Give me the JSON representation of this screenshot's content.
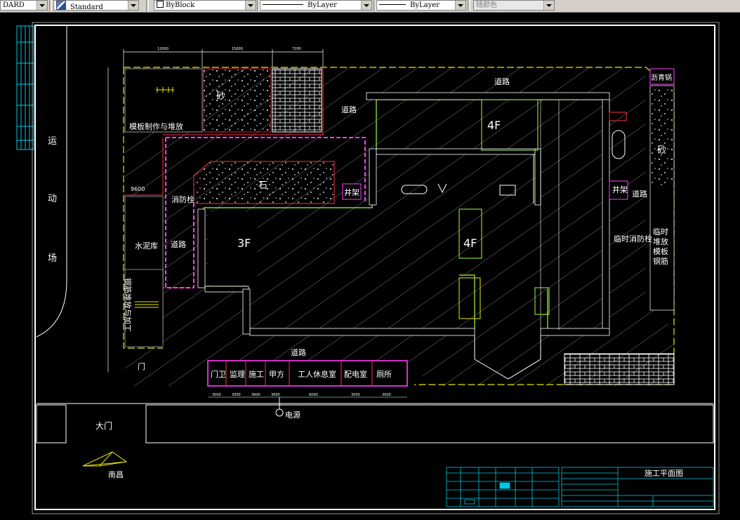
{
  "toolbar": {
    "textstyle": "DARD",
    "dimstyle": "Standard",
    "layer": "ByBlock",
    "linetype": "ByLayer",
    "lineweight": "ByLayer",
    "plotstyle": "随颜色"
  },
  "drawing": {
    "left_road": [
      "运",
      "动",
      "场"
    ],
    "gate": "门",
    "main_gate": "大门",
    "power": "电源",
    "north": "南昌",
    "dims_top": [
      "12000",
      "15000",
      "7200"
    ],
    "dims_bottom": [
      "3000",
      "3000",
      "3900",
      "3000",
      "6000",
      "3000",
      "3000"
    ],
    "areas": {
      "formwork_yard": "模板制作与堆放",
      "sand": "砂",
      "stone": "石",
      "fire_hydrant_1": "消防栓",
      "road_1": "道路",
      "road_2": "道路",
      "road_3": "道路",
      "road_4": "道路",
      "road_5": "道路",
      "cement": "水泥库",
      "steel_yard": "钢筋堆放与加工",
      "hoist_1": "井架",
      "hoist_2": "井架",
      "temp_hydrant": "临时消防栓",
      "asphalt": "沥青锅",
      "sand_right": "砂",
      "right_store": "临时堆放模板钢筋"
    },
    "buildings": {
      "b3f": "3F",
      "b4f_top": "4F",
      "b4f_mid": "4F"
    },
    "rooms": [
      "门卫",
      "监理",
      "施工",
      "甲方",
      "工人休息室",
      "配电室",
      "厕所"
    ],
    "title_block": {
      "title": "施工平面图"
    }
  }
}
